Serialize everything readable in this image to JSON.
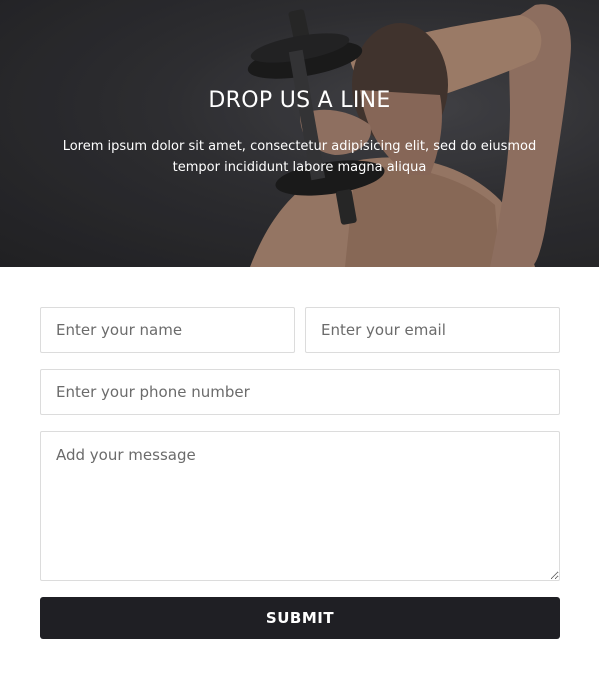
{
  "hero": {
    "title": "DROP US A LINE",
    "text": "Lorem ipsum dolor sit amet, consectetur adipisicing elit, sed do eiusmod tempor incididunt labore magna aliqua",
    "image_subject": "man-lifting-dumbbell"
  },
  "form": {
    "name_placeholder": "Enter your name",
    "email_placeholder": "Enter your email",
    "phone_placeholder": "Enter your phone number",
    "message_placeholder": "Add your message",
    "submit_label": "SUBMIT"
  },
  "colors": {
    "hero_bg": "#2e2e32",
    "button_bg": "#1f1f24",
    "button_text": "#ffffff",
    "field_border": "#dcdcdc"
  }
}
